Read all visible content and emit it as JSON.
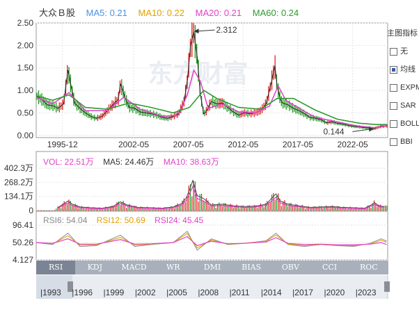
{
  "header": {
    "title": "大众Ｂ股",
    "ma5": "MA5: 0.21",
    "ma10": "MA10: 0.22",
    "ma20": "MA20: 0.21",
    "ma60": "MA60: 0.24"
  },
  "colors": {
    "ma5": "#4a90e2",
    "ma10": "#e0a000",
    "ma20": "#e040c8",
    "ma60": "#2e9a2e",
    "up": "#e02020",
    "down": "#1a9a1a",
    "price_line": "#222222",
    "rsi6": "#888888",
    "rsi12": "#e0a000",
    "rsi24": "#e040c8"
  },
  "chart_data": [
    {
      "type": "line",
      "name": "price",
      "ytick_labels": [
        "2.50",
        "2.00",
        "1.50",
        "1.00",
        "0.50",
        "0.00"
      ],
      "yticks": [
        2.5,
        2.0,
        1.5,
        1.0,
        0.5,
        0.0
      ],
      "ylim": [
        -0.05,
        2.5
      ],
      "xlim": [
        1993.5,
        2025.6
      ],
      "xtick_labels": [
        "1995-12",
        "2002-05",
        "2007-05",
        "2012-05",
        "2017-05",
        "2022-05"
      ],
      "xticks": [
        1995.9,
        2002.4,
        2007.4,
        2012.4,
        2017.4,
        2022.4
      ],
      "annotations": [
        {
          "text": "2.312",
          "x": 2007.9,
          "y": 2.312
        },
        {
          "text": "0.144",
          "x": 2024.3,
          "y": 0.144
        }
      ],
      "series": [
        {
          "key": "close",
          "x": [
            1993.5,
            1994.0,
            1994.5,
            1995.0,
            1995.5,
            1996.0,
            1996.4,
            1996.6,
            1997.0,
            1997.5,
            1998.0,
            1998.5,
            1999.0,
            1999.5,
            2000.0,
            2000.5,
            2001.0,
            2001.2,
            2001.6,
            2002.0,
            2002.5,
            2003.0,
            2003.5,
            2004.0,
            2004.5,
            2005.0,
            2005.5,
            2006.0,
            2006.5,
            2007.0,
            2007.3,
            2007.6,
            2007.9,
            2008.2,
            2008.5,
            2008.8,
            2009.0,
            2009.5,
            2010.0,
            2010.5,
            2011.0,
            2011.5,
            2012.0,
            2012.5,
            2013.0,
            2013.5,
            2014.0,
            2014.5,
            2015.0,
            2015.3,
            2015.5,
            2015.8,
            2016.0,
            2016.5,
            2017.0,
            2017.5,
            2018.0,
            2018.5,
            2019.0,
            2019.5,
            2020.0,
            2020.5,
            2021.0,
            2021.5,
            2022.0,
            2022.5,
            2023.0,
            2023.5,
            2024.0,
            2024.3,
            2024.6,
            2025.0,
            2025.5
          ],
          "y": [
            0.88,
            0.8,
            0.68,
            0.66,
            0.6,
            0.7,
            1.45,
            1.2,
            0.72,
            0.6,
            0.5,
            0.42,
            0.38,
            0.42,
            0.55,
            0.68,
            0.8,
            1.15,
            0.85,
            0.62,
            0.6,
            0.52,
            0.5,
            0.48,
            0.45,
            0.4,
            0.38,
            0.42,
            0.48,
            0.75,
            1.2,
            2.0,
            2.3,
            1.75,
            0.9,
            0.48,
            0.52,
            0.75,
            0.7,
            0.72,
            0.62,
            0.52,
            0.45,
            0.5,
            0.48,
            0.5,
            0.55,
            0.7,
            1.2,
            1.55,
            1.1,
            0.8,
            0.72,
            0.68,
            0.6,
            0.55,
            0.48,
            0.4,
            0.38,
            0.35,
            0.28,
            0.3,
            0.27,
            0.25,
            0.22,
            0.2,
            0.19,
            0.17,
            0.16,
            0.144,
            0.17,
            0.2,
            0.21
          ]
        },
        {
          "key": "ma20",
          "x": [
            1993.5,
            1995.0,
            1996.5,
            1998.0,
            2000.0,
            2001.5,
            2003.0,
            2005.0,
            2006.5,
            2007.3,
            2007.9,
            2008.5,
            2009.2,
            2010.5,
            2012.0,
            2013.5,
            2014.8,
            2015.6,
            2016.3,
            2017.5,
            2019.0,
            2021.0,
            2023.0,
            2024.5,
            2025.5
          ],
          "y": [
            0.85,
            0.7,
            0.95,
            0.55,
            0.55,
            0.85,
            0.58,
            0.42,
            0.45,
            0.9,
            1.45,
            1.2,
            0.6,
            0.7,
            0.52,
            0.5,
            0.65,
            1.1,
            0.78,
            0.6,
            0.4,
            0.3,
            0.2,
            0.17,
            0.21
          ]
        },
        {
          "key": "ma60",
          "x": [
            1993.5,
            1995.0,
            1996.5,
            1998.0,
            2000.0,
            2002.0,
            2004.0,
            2006.0,
            2007.5,
            2008.8,
            2010.0,
            2012.0,
            2014.0,
            2015.5,
            2017.0,
            2019.0,
            2021.0,
            2023.0,
            2024.5,
            2025.5
          ],
          "y": [
            0.88,
            0.78,
            0.9,
            0.62,
            0.58,
            0.72,
            0.62,
            0.5,
            0.62,
            1.0,
            0.82,
            0.62,
            0.58,
            0.82,
            0.82,
            0.56,
            0.36,
            0.27,
            0.24,
            0.24
          ]
        }
      ]
    },
    {
      "type": "bar",
      "name": "volume",
      "ytick_labels": [
        "402.3万",
        "268.2万",
        "134.1万",
        "0"
      ],
      "yticks": [
        402.3,
        268.2,
        134.1,
        0
      ],
      "ylim": [
        0,
        402.3
      ],
      "legend": {
        "vol": "VOL: 22.51万",
        "ma5": "MA5: 24.46万",
        "ma10": "MA10: 38.63万"
      },
      "x": [
        1995.5,
        1996.4,
        1996.8,
        1997.5,
        1998.5,
        1999.5,
        2000.5,
        2001.2,
        2001.8,
        2002.8,
        2004.0,
        2005.0,
        2006.0,
        2006.8,
        2007.2,
        2007.5,
        2007.8,
        2008.2,
        2008.8,
        2009.5,
        2010.5,
        2011.5,
        2012.5,
        2013.5,
        2014.5,
        2015.1,
        2015.4,
        2015.8,
        2016.5,
        2017.5,
        2018.5,
        2019.5,
        2020.5,
        2021.5,
        2022.5,
        2023.5,
        2024.1,
        2024.4,
        2024.8,
        2025.3
      ],
      "values": [
        40,
        120,
        80,
        45,
        35,
        30,
        50,
        110,
        70,
        40,
        35,
        30,
        45,
        90,
        160,
        260,
        380,
        190,
        150,
        70,
        80,
        60,
        50,
        55,
        80,
        170,
        210,
        120,
        80,
        60,
        40,
        45,
        50,
        40,
        35,
        30,
        70,
        100,
        60,
        50
      ]
    },
    {
      "type": "line",
      "name": "rsi",
      "ytick_labels": [
        "96.41",
        "50.26",
        "4.127"
      ],
      "yticks": [
        96.41,
        50.26,
        4.127
      ],
      "ylim": [
        4.127,
        96.41
      ],
      "legend": {
        "rsi6": "RSI6: 54.04",
        "rsi12": "RSI12: 50.69",
        "rsi24": "RSI24: 45.45"
      },
      "x": [
        1993.5,
        1995.0,
        1996.4,
        1997.5,
        1999.0,
        2001.2,
        2002.5,
        2004.0,
        2006.0,
        2007.3,
        2008.2,
        2009.5,
        2011.0,
        2012.5,
        2014.5,
        2015.4,
        2016.5,
        2018.0,
        2019.5,
        2021.0,
        2022.5,
        2024.0,
        2025.0,
        2025.5
      ],
      "rsi6": [
        50,
        45,
        75,
        40,
        42,
        70,
        40,
        45,
        50,
        80,
        30,
        60,
        45,
        48,
        55,
        75,
        45,
        40,
        45,
        42,
        40,
        48,
        60,
        54
      ],
      "rsi12": [
        50,
        47,
        68,
        43,
        44,
        64,
        43,
        46,
        50,
        74,
        36,
        57,
        46,
        48,
        54,
        70,
        46,
        42,
        45,
        43,
        42,
        47,
        56,
        51
      ],
      "rsi24": [
        50,
        48,
        60,
        46,
        46,
        58,
        46,
        47,
        50,
        66,
        42,
        54,
        47,
        48,
        52,
        63,
        48,
        45,
        46,
        44,
        44,
        46,
        50,
        45
      ]
    }
  ],
  "watermark": "东方财富",
  "sidebar": {
    "title": "主图指标",
    "items": [
      {
        "label": "无",
        "checked": false
      },
      {
        "label": "均线",
        "checked": true
      },
      {
        "label": "EXPMA",
        "checked": false
      },
      {
        "label": "SAR",
        "checked": false
      },
      {
        "label": "BOLL",
        "checked": false
      },
      {
        "label": "BBI",
        "checked": false
      }
    ]
  },
  "tabs": [
    "RSI",
    "KDJ",
    "MACD",
    "WR",
    "DMI",
    "BIAS",
    "OBV",
    "CCI",
    "ROC"
  ],
  "active_tab": "RSI",
  "timeline_years": [
    "1993",
    "1996",
    "1999",
    "2002",
    "2005",
    "2008",
    "2011",
    "2014",
    "2017",
    "2020",
    "2023"
  ]
}
